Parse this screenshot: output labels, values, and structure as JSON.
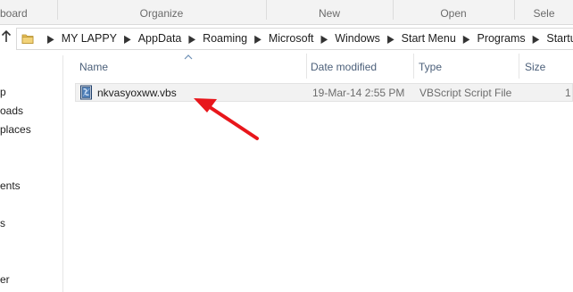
{
  "ribbon": {
    "groups": [
      "board",
      "Organize",
      "New",
      "Open",
      "Sele"
    ]
  },
  "address": {
    "crumbs": [
      "MY LAPPY",
      "AppData",
      "Roaming",
      "Microsoft",
      "Windows",
      "Start Menu",
      "Programs",
      "Startup"
    ],
    "separator": "▶"
  },
  "nav": {
    "items": [
      "p",
      "oads",
      "places",
      "ents",
      "s",
      "er"
    ]
  },
  "columns": {
    "name": "Name",
    "date_modified": "Date modified",
    "type": "Type",
    "size": "Size"
  },
  "files": [
    {
      "name": "nkvasyoxww.vbs",
      "date_modified": "19-Mar-14 2:55 PM",
      "type": "VBScript Script File",
      "size": "1"
    }
  ],
  "icons": {
    "up": "up-arrow-icon",
    "folder": "folder-icon",
    "file": "vbscript-file-icon",
    "sort": "sort-ascending-icon"
  },
  "colors": {
    "annotation_arrow": "#e8161b",
    "column_header_text": "#4c607a",
    "selected_row": "#f2f2f2"
  }
}
